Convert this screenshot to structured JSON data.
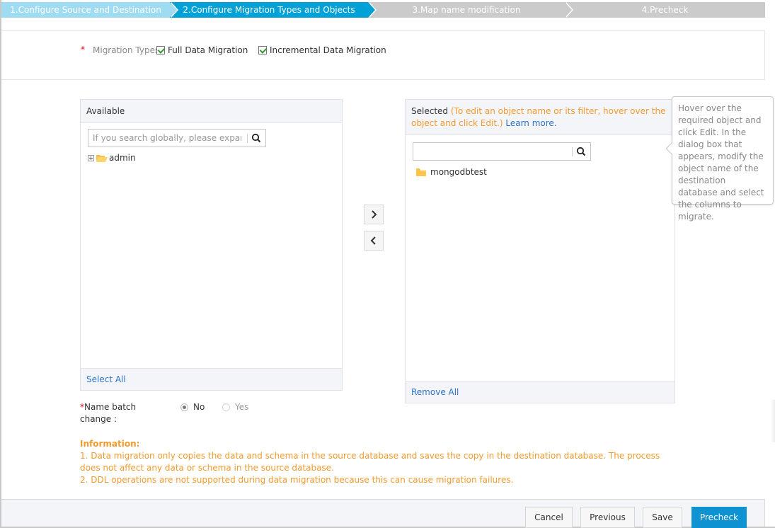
{
  "steps": [
    {
      "label": "1.Configure Source and Destination",
      "state": "completed"
    },
    {
      "label": "2.Configure Migration Types and Objects",
      "state": "active"
    },
    {
      "label": "3.Map name modification",
      "state": "pending"
    },
    {
      "label": "4.Precheck",
      "state": "pending"
    }
  ],
  "migration_types": {
    "required_mark": "*",
    "label": "Migration Types:",
    "options": [
      {
        "label": "Full Data Migration",
        "checked": true
      },
      {
        "label": "Incremental Data Migration",
        "checked": true
      }
    ]
  },
  "available": {
    "header": "Available",
    "search_placeholder": "If you search globally, please expand",
    "search_value": "",
    "items": [
      {
        "label": "admin",
        "expandable": true
      }
    ],
    "footer_link": "Select All"
  },
  "transfer": {
    "move_right_icon": "chevron-right-icon",
    "move_left_icon": "chevron-left-icon"
  },
  "selected": {
    "header_label": "Selected",
    "header_hint": "(To edit an object name or its filter, hover over the object and click Edit.)",
    "learn_more": "Learn more.",
    "search_placeholder": "",
    "search_value": "",
    "items": [
      {
        "label": "mongodbtest"
      }
    ],
    "footer_link": "Remove All"
  },
  "tooltip": {
    "text": "Hover over the required object and click Edit. In the dialog box that appears, modify the object name of the destination database and select the columns to migrate."
  },
  "name_batch_change": {
    "required_mark": "*",
    "label": "Name batch change :",
    "options": [
      {
        "label": "No",
        "selected": true
      },
      {
        "label": "Yes",
        "selected": false
      }
    ]
  },
  "information": {
    "title": "Information:",
    "lines": [
      "1. Data migration only copies the data and schema in the source database and saves the copy in the destination database. The process does not affect any data or schema in the source database.",
      "2. DDL operations are not supported during data migration because this can cause migration failures."
    ]
  },
  "footer": {
    "cancel": "Cancel",
    "previous": "Previous",
    "save": "Save",
    "precheck": "Precheck"
  },
  "colors": {
    "step_active": "#00a1d6",
    "step_done": "#9fdcf2",
    "step_pending": "#cbcbcb",
    "primary_button": "#0f92d1",
    "info_orange": "#f39a2e",
    "link_blue": "#2b73c8",
    "required_red": "#ee0000"
  }
}
